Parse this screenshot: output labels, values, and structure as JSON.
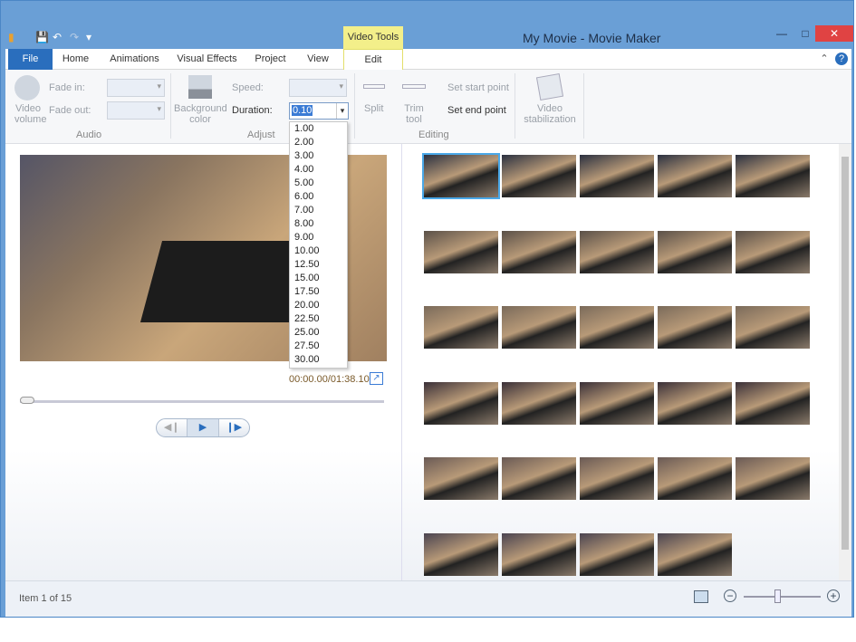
{
  "window": {
    "title": "My Movie - Movie Maker",
    "context_tab": "Video Tools",
    "minimize": "—",
    "maximize": "□",
    "close": "✕"
  },
  "qat": {
    "save": "💾",
    "undo": "↶",
    "redo": "↷",
    "customize": "▾"
  },
  "tabs": [
    "File",
    "Home",
    "Animations",
    "Visual Effects",
    "Project",
    "View",
    "Edit"
  ],
  "help": {
    "collapse": "⌃",
    "help": "?"
  },
  "ribbon": {
    "audio": {
      "video_volume": "Video volume",
      "fade_in": "Fade in:",
      "fade_out": "Fade out:",
      "group": "Audio"
    },
    "adjust": {
      "background_color": "Background color",
      "speed": "Speed:",
      "duration": "Duration:",
      "duration_value": "0.10",
      "group": "Adjust"
    },
    "editing": {
      "split": "Split",
      "trim_tool": "Trim tool",
      "set_start_point": "Set start point",
      "set_end_point": "Set end point",
      "group": "Editing"
    },
    "stabilization": {
      "label": "Video stabilization"
    }
  },
  "duration_options": [
    "1.00",
    "2.00",
    "3.00",
    "4.00",
    "5.00",
    "6.00",
    "7.00",
    "8.00",
    "9.00",
    "10.00",
    "12.50",
    "15.00",
    "17.50",
    "20.00",
    "22.50",
    "25.00",
    "27.50",
    "30.00"
  ],
  "preview": {
    "timecode": "00:00.00/01:38.10",
    "seek_position": 0,
    "prev_frame": "◀❙",
    "play": "▶",
    "next_frame": "❙▶"
  },
  "storyboard": {
    "row_counts": [
      5,
      5,
      5,
      5,
      5,
      4
    ],
    "selected_index": 0
  },
  "status": {
    "item": "Item 1 of 15",
    "zoom_out": "−",
    "zoom_in": "+",
    "zoom_level_fraction": 0.45
  },
  "colors": {
    "title_bar": "#6a9fd6",
    "file_tab": "#2a6ebd",
    "context_tab": "#f3ef8a",
    "close": "#e04343"
  }
}
